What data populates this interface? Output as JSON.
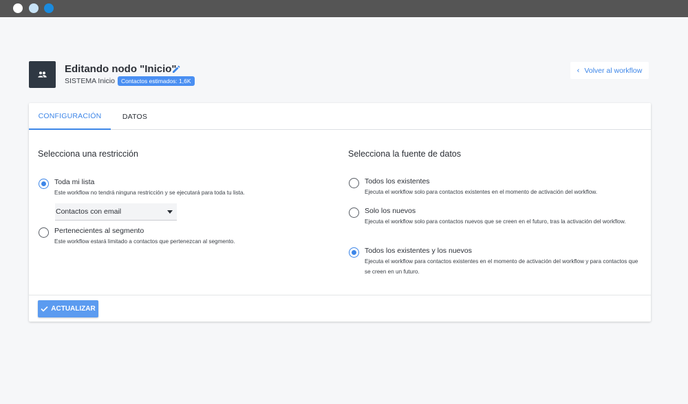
{
  "window": {
    "controls": [
      "close",
      "minimize",
      "maximize"
    ]
  },
  "header": {
    "avatar_icon": "group-icon",
    "title": "Editando nodo \"Inicio\"",
    "edit_icon": "pencil-icon",
    "subtitle": "SISTEMA Inicio",
    "badge": "Contactos estimados: 1,6K",
    "back_label": "Volver al workflow"
  },
  "tabs": [
    {
      "label": "CONFIGURACIÓN",
      "active": true
    },
    {
      "label": "DATOS",
      "active": false
    }
  ],
  "restriction": {
    "title": "Selecciona una restricción",
    "options": [
      {
        "label": "Toda mi lista",
        "desc": "Este workflow no tendrá ninguna restricción y se ejecutará para toda tu lista.",
        "checked": true
      },
      {
        "label": "Pertenecientes al segmento",
        "desc": "Este workflow estará limitado a contactos que pertenezcan al segmento.",
        "checked": false
      }
    ],
    "select_value": "Contactos con email"
  },
  "source": {
    "title": "Selecciona la fuente de datos",
    "options": [
      {
        "label": "Todos los existentes",
        "desc": "Ejecuta el workflow solo para contactos existentes en el momento de activación del workflow.",
        "checked": false
      },
      {
        "label": "Solo los nuevos",
        "desc": "Ejecuta el workflow solo para contactos nuevos que se creen en el futuro, tras la activación del workflow.",
        "checked": false
      },
      {
        "label": "Todos los existentes y los nuevos",
        "desc": "Ejecuta el workflow para contactos existentes en el momento de activación del workflow y para contactos que se creen en un futuro.",
        "checked": true
      }
    ]
  },
  "footer": {
    "update_label": "ACTUALIZAR"
  },
  "colors": {
    "accent": "#3d86e8",
    "button": "#5b9bf0",
    "avatar_bg": "#2f3843",
    "titlebar": "#555555"
  }
}
